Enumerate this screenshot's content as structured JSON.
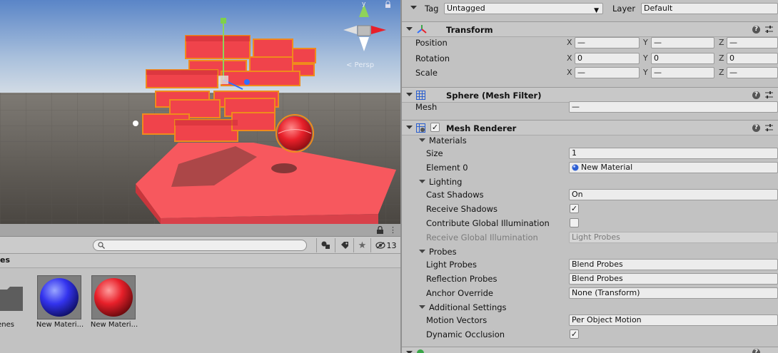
{
  "scene": {
    "gizmo_label": "< Persp"
  },
  "project": {
    "search": {
      "placeholder": ""
    },
    "visible_count": "13",
    "path_label": "es",
    "assets": [
      {
        "label": "enes",
        "kind": "folder"
      },
      {
        "label": "New Materi...",
        "kind": "material",
        "color": "#3333ee"
      },
      {
        "label": "New Materi...",
        "kind": "material",
        "color": "#e8202a"
      }
    ]
  },
  "inspector": {
    "tag_label": "Tag",
    "tag_value": "Untagged",
    "layer_label": "Layer",
    "layer_value": "Default",
    "transform": {
      "title": "Transform",
      "position": {
        "label": "Position",
        "x": "—",
        "y": "—",
        "z": "—"
      },
      "rotation": {
        "label": "Rotation",
        "x": "0",
        "y": "0",
        "z": "0"
      },
      "scale": {
        "label": "Scale",
        "x": "—",
        "y": "—",
        "z": "—"
      },
      "axis_x": "X",
      "axis_y": "Y",
      "axis_z": "Z"
    },
    "mesh_filter": {
      "title": "Sphere (Mesh Filter)",
      "mesh_label": "Mesh",
      "mesh_value": "—"
    },
    "mesh_renderer": {
      "title": "Mesh Renderer",
      "materials_label": "Materials",
      "size_label": "Size",
      "size_value": "1",
      "element0_label": "Element 0",
      "element0_value": "New Material",
      "lighting_label": "Lighting",
      "cast_shadows_label": "Cast Shadows",
      "cast_shadows_value": "On",
      "receive_shadows_label": "Receive Shadows",
      "receive_shadows_checked": true,
      "contribute_gi_label": "Contribute Global Illumination",
      "contribute_gi_checked": false,
      "receive_gi_label": "Receive Global Illumination",
      "receive_gi_value": "Light Probes",
      "probes_label": "Probes",
      "light_probes_label": "Light Probes",
      "light_probes_value": "Blend Probes",
      "reflection_probes_label": "Reflection Probes",
      "reflection_probes_value": "Blend Probes",
      "anchor_override_label": "Anchor Override",
      "anchor_override_value": "None (Transform)",
      "additional_label": "Additional Settings",
      "motion_vectors_label": "Motion Vectors",
      "motion_vectors_value": "Per Object Motion",
      "dynamic_occlusion_label": "Dynamic Occlusion",
      "dynamic_occlusion_checked": true
    },
    "check_mark": "✓",
    "help_glyph": "?"
  },
  "colors": {
    "panel_bg": "#c2c2c2",
    "brick_red": "#f0434b",
    "selection_orange": "#f08a1c"
  }
}
